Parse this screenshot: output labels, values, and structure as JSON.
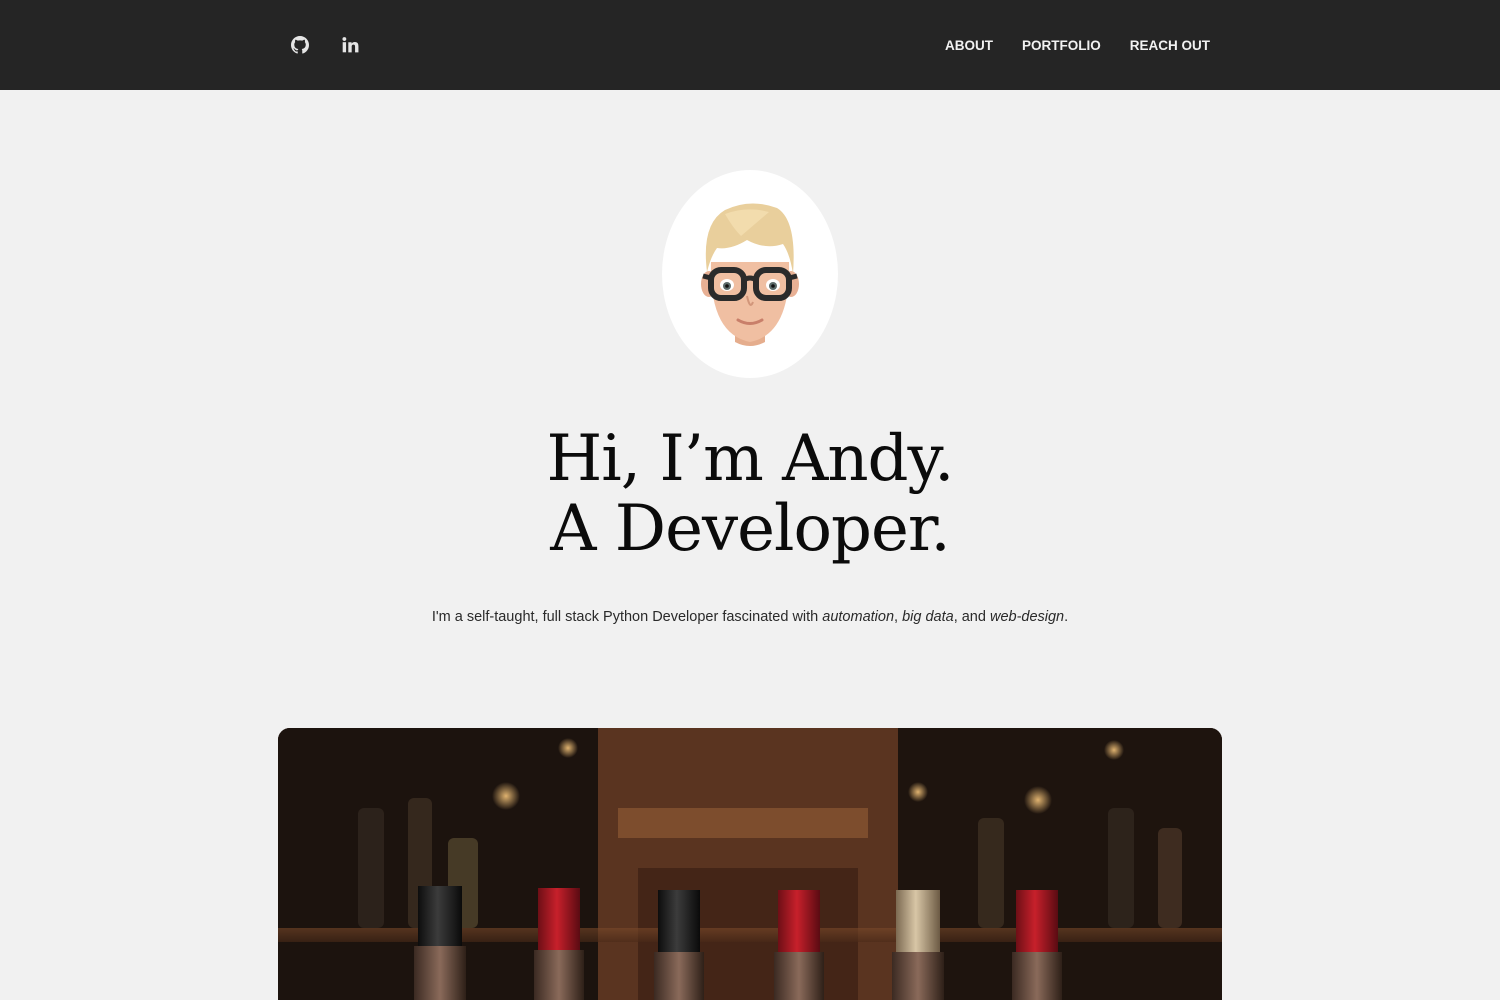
{
  "header": {
    "social": [
      {
        "name": "github-icon"
      },
      {
        "name": "linkedin-icon"
      }
    ],
    "nav": [
      {
        "label": "ABOUT"
      },
      {
        "label": "PORTFOLIO"
      },
      {
        "label": "REACH OUT"
      }
    ]
  },
  "hero": {
    "headline_line1": "Hi, I’m Andy.",
    "headline_line2": "A Developer.",
    "tagline_prefix": "I'm a self-taught, full stack Python Developer fascinated with ",
    "tagline_em1": "automation",
    "tagline_sep1": ", ",
    "tagline_em2": "big data",
    "tagline_sep2": ", and ",
    "tagline_em3": "web-design",
    "tagline_suffix": "."
  },
  "colors": {
    "topbar": "#252525",
    "background": "#f1f1f1",
    "headline": "#0b0b0b"
  }
}
